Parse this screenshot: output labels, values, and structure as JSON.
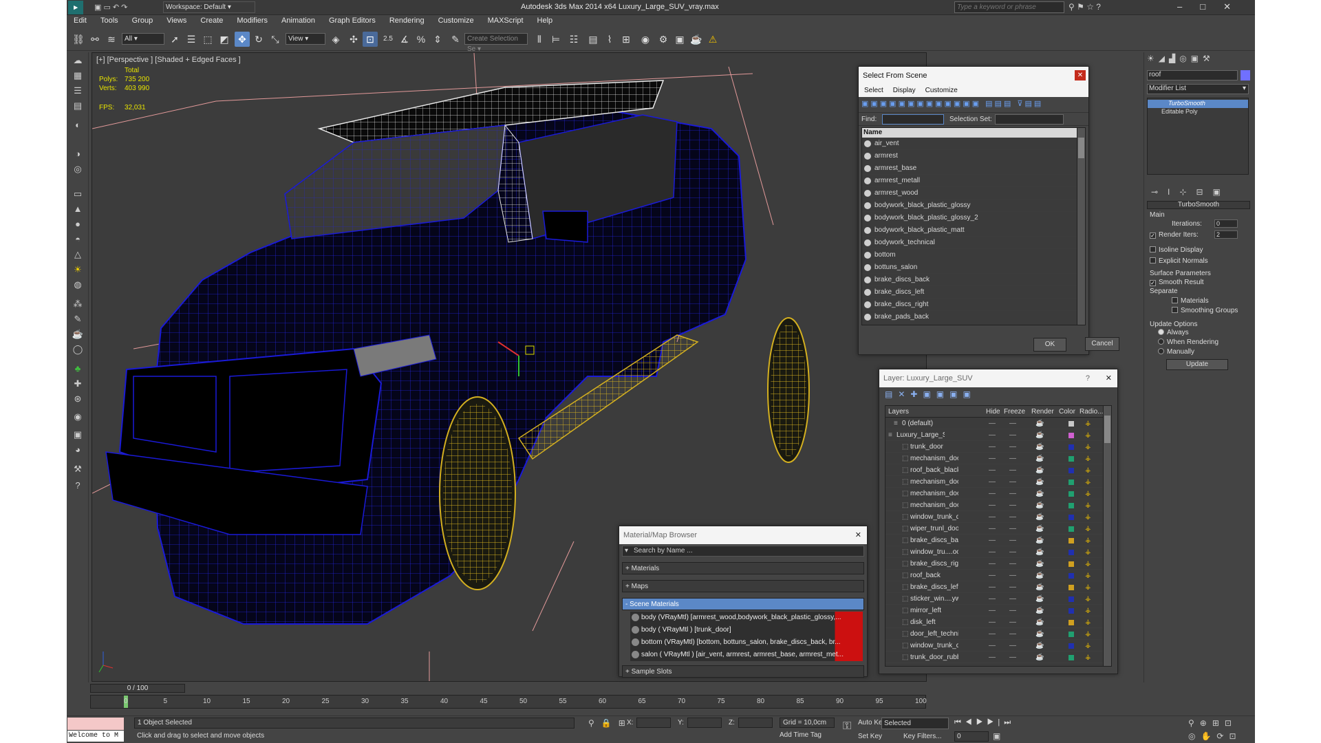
{
  "window": {
    "title": "Autodesk 3ds Max  2014 x64     Luxury_Large_SUV_vray.max",
    "workspace": "Workspace: Default",
    "search_placeholder": "Type a keyword or phrase"
  },
  "menu": [
    "Edit",
    "Tools",
    "Group",
    "Views",
    "Create",
    "Modifiers",
    "Animation",
    "Graph Editors",
    "Rendering",
    "Customize",
    "MAXScript",
    "Help"
  ],
  "toolbar": {
    "filter": "All",
    "refcoord": "View",
    "snap_angle": "2.5",
    "selection_set": "Create Selection Se"
  },
  "viewport": {
    "label": "[+] [Perspective ] [Shaded + Edged Faces ]",
    "stats": {
      "total_label": "Total",
      "polys_label": "Polys:",
      "polys": "735 200",
      "verts_label": "Verts:",
      "verts": "403 990",
      "fps_label": "FPS:",
      "fps": "32,031"
    }
  },
  "select_scene": {
    "title": "Select From Scene",
    "menu": [
      "Select",
      "Display",
      "Customize"
    ],
    "find_label": "Find:",
    "selset_label": "Selection Set:",
    "column": "Name",
    "items": [
      "air_vent",
      "armrest",
      "armrest_base",
      "armrest_metall",
      "armrest_wood",
      "bodywork_black_plastic_glossy",
      "bodywork_black_plastic_glossy_2",
      "bodywork_black_plastic_matt",
      "bodywork_technical",
      "bottom",
      "bottuns_salon",
      "brake_discs_back",
      "brake_discs_left",
      "brake_discs_right",
      "brake_pads_back"
    ],
    "ok": "OK",
    "cancel": "Cancel"
  },
  "layer": {
    "title": "Layer: Luxury_Large_SUV",
    "headers": [
      "Layers",
      "Hide",
      "Freeze",
      "Render",
      "Color",
      "Radio..."
    ],
    "rows": [
      {
        "name": "0 (default)",
        "color": "#c8c8c8"
      },
      {
        "name": "Luxury_Large_SUV",
        "color": "#d060d0"
      },
      {
        "name": "trunk_door",
        "color": "#2030b0"
      },
      {
        "name": "mechanism_door",
        "color": "#20a070"
      },
      {
        "name": "roof_back_black",
        "color": "#2030b0"
      },
      {
        "name": "mechanism_door",
        "color": "#20a070"
      },
      {
        "name": "mechanism_door",
        "color": "#20a070"
      },
      {
        "name": "mechanism_door",
        "color": "#20a070"
      },
      {
        "name": "window_trunk_d",
        "color": "#2030b0"
      },
      {
        "name": "wiper_trunl_door",
        "color": "#20a070"
      },
      {
        "name": "brake_discs_bac",
        "color": "#d0a020"
      },
      {
        "name": "window_tru....oo",
        "color": "#2030b0"
      },
      {
        "name": "brake_discs_righ",
        "color": "#d0a020"
      },
      {
        "name": "roof_back",
        "color": "#2030b0"
      },
      {
        "name": "brake_discs_left",
        "color": "#d0a020"
      },
      {
        "name": "sticker_win....yw",
        "color": "#2030b0"
      },
      {
        "name": "mirror_left",
        "color": "#2030b0"
      },
      {
        "name": "disk_left",
        "color": "#d0a020"
      },
      {
        "name": "door_left_techni",
        "color": "#20a070"
      },
      {
        "name": "window_trunk_d",
        "color": "#2030b0"
      },
      {
        "name": "trunk_door_rubb",
        "color": "#20a070"
      }
    ]
  },
  "material_browser": {
    "title": "Material/Map Browser",
    "search_placeholder": "Search by Name ...",
    "sections": [
      "+ Materials",
      "+ Maps",
      "- Scene Materials",
      "+ Sample Slots"
    ],
    "scene_materials": [
      "body (VRayMtl) [armrest_wood,bodywork_black_plastic_glossy,...",
      "body  ( VRayMtl ) [trunk_door]",
      "bottom (VRayMtl) [bottom, bottuns_salon, brake_discs_back, br...",
      "salon  ( VRayMtl ) [air_vent, armrest, armrest_base, armrest_met..."
    ]
  },
  "cmdpanel": {
    "name": "roof",
    "modifier_list": "Modifier List",
    "stack": [
      "TurboSmooth",
      "Editable Poly"
    ],
    "rollout": "TurboSmooth",
    "main": "Main",
    "iterations_label": "Iterations:",
    "iterations": "0",
    "render_iters_label": "Render Iters:",
    "render_iters": "2",
    "isoline": "Isoline Display",
    "explicit": "Explicit Normals",
    "surface": "Surface Parameters",
    "smooth_result": "Smooth Result",
    "separate": "Separate",
    "materials": "Materials",
    "smoothing_groups": "Smoothing Groups",
    "update_options": "Update Options",
    "always": "Always",
    "when_rendering": "When Rendering",
    "manually": "Manually",
    "update": "Update"
  },
  "timeline": {
    "frame": "0 / 100",
    "ticks": [
      "0",
      "5",
      "10",
      "15",
      "20",
      "25",
      "30",
      "35",
      "40",
      "45",
      "50",
      "55",
      "60",
      "65",
      "70",
      "75",
      "80",
      "85",
      "90",
      "95",
      "100"
    ]
  },
  "status": {
    "listener": "Welcome to M",
    "selected": "1 Object Selected",
    "prompt": "Click and drag to select and move objects",
    "x_label": "X:",
    "y_label": "Y:",
    "z_label": "Z:",
    "grid": "Grid = 10,0cm",
    "add_time_tag": "Add Time Tag",
    "auto_key": "Auto Key",
    "set_key": "Set Key",
    "selected_dd": "Selected",
    "key_filters": "Key Filters...",
    "frame": "0"
  },
  "colors": {
    "accent": "#5b88c7",
    "wire_blue": "#1a1ad8",
    "wire_gold": "#d4b020"
  }
}
